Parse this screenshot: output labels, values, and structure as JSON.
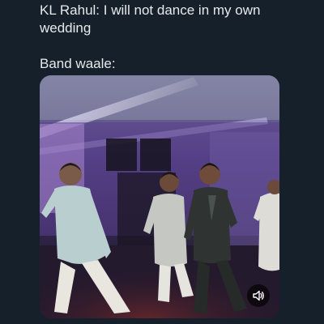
{
  "tweet": {
    "line1": "KL Rahul: I will not dance in my own wedding",
    "line2": "Band waale:"
  },
  "media": {
    "type": "video",
    "scene": "wedding-dance-video-still",
    "controls": {
      "volume_icon": "speaker-icon"
    }
  },
  "colors": {
    "background": "#15202b",
    "text": "#e7e9ea",
    "stage_light": "#c9b8ff"
  }
}
